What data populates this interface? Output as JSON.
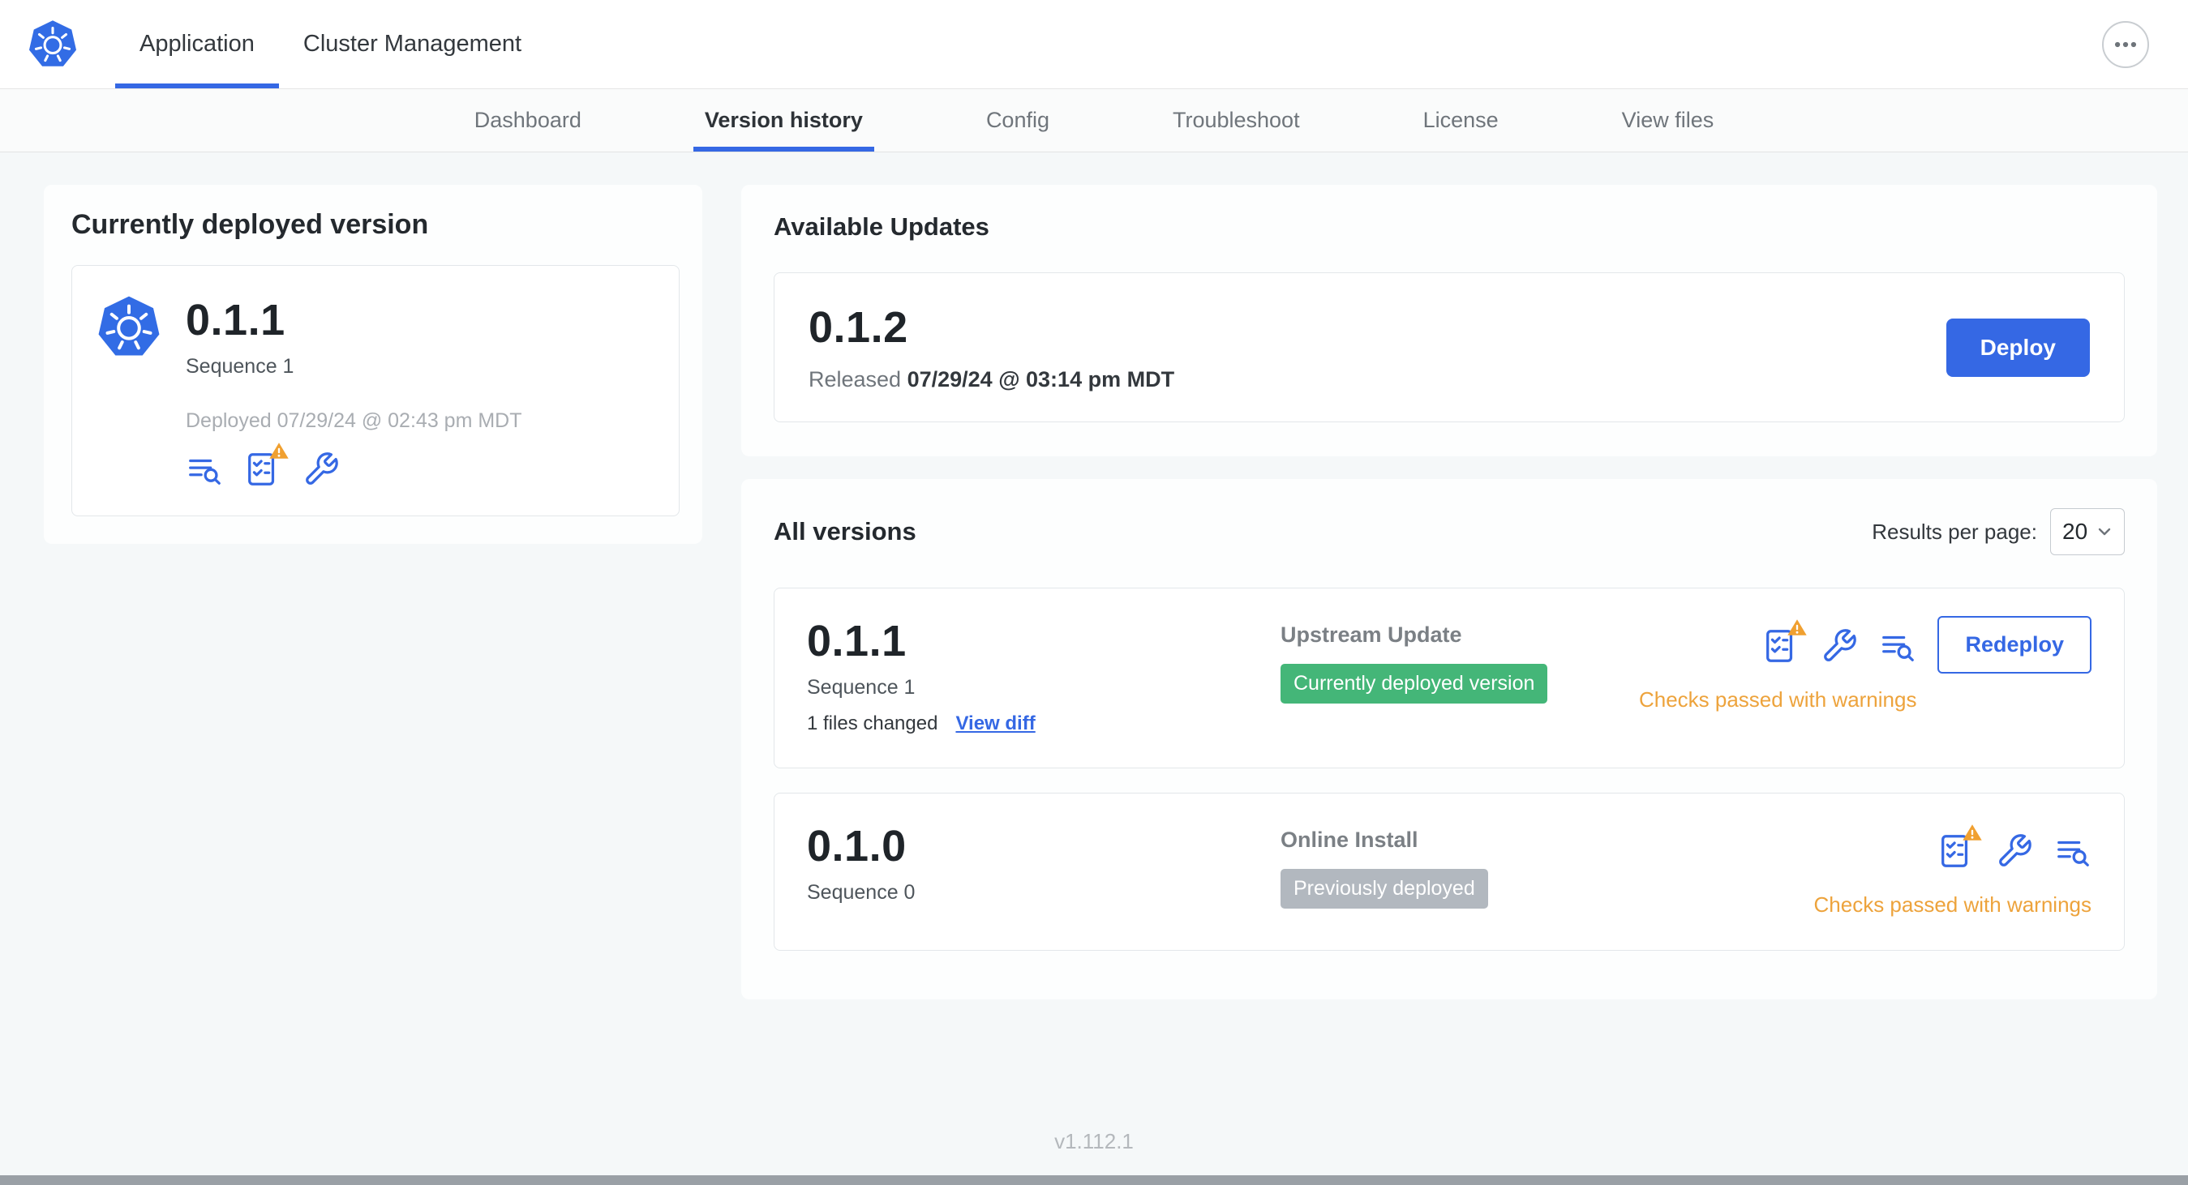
{
  "colors": {
    "accent_blue": "#3568e4",
    "kubernetes_blue": "#326ce5",
    "success_green": "#44b678",
    "neutral_badge_gray": "#b2b8bf",
    "warning_orange": "#eda33c"
  },
  "header": {
    "tabs": [
      {
        "label": "Application"
      },
      {
        "label": "Cluster Management"
      }
    ]
  },
  "subnav": {
    "items": [
      "Dashboard",
      "Version history",
      "Config",
      "Troubleshoot",
      "License",
      "View files"
    ],
    "active": "Version history"
  },
  "current_version": {
    "title": "Currently deployed version",
    "version": "0.1.1",
    "sequence": "Sequence 1",
    "deployed": "Deployed 07/29/24 @ 02:43 pm MDT"
  },
  "available_updates": {
    "title": "Available Updates",
    "version": "0.1.2",
    "released_prefix": "Released",
    "released_date": "07/29/24 @ 03:14 pm MDT",
    "deploy_label": "Deploy"
  },
  "all_versions": {
    "title": "All versions",
    "results_per_page_label": "Results per page:",
    "results_per_page_value": "20",
    "rows": [
      {
        "version": "0.1.1",
        "sequence": "Sequence 1",
        "files_changed": "1 files changed",
        "view_diff_label": "View diff",
        "source": "Upstream Update",
        "badge": "Currently deployed version",
        "checks": "Checks passed with warnings",
        "action_label": "Redeploy"
      },
      {
        "version": "0.1.0",
        "sequence": "Sequence 0",
        "source": "Online Install",
        "badge": "Previously deployed",
        "checks": "Checks passed with warnings"
      }
    ]
  },
  "footer": {
    "app_version": "v1.112.1"
  }
}
